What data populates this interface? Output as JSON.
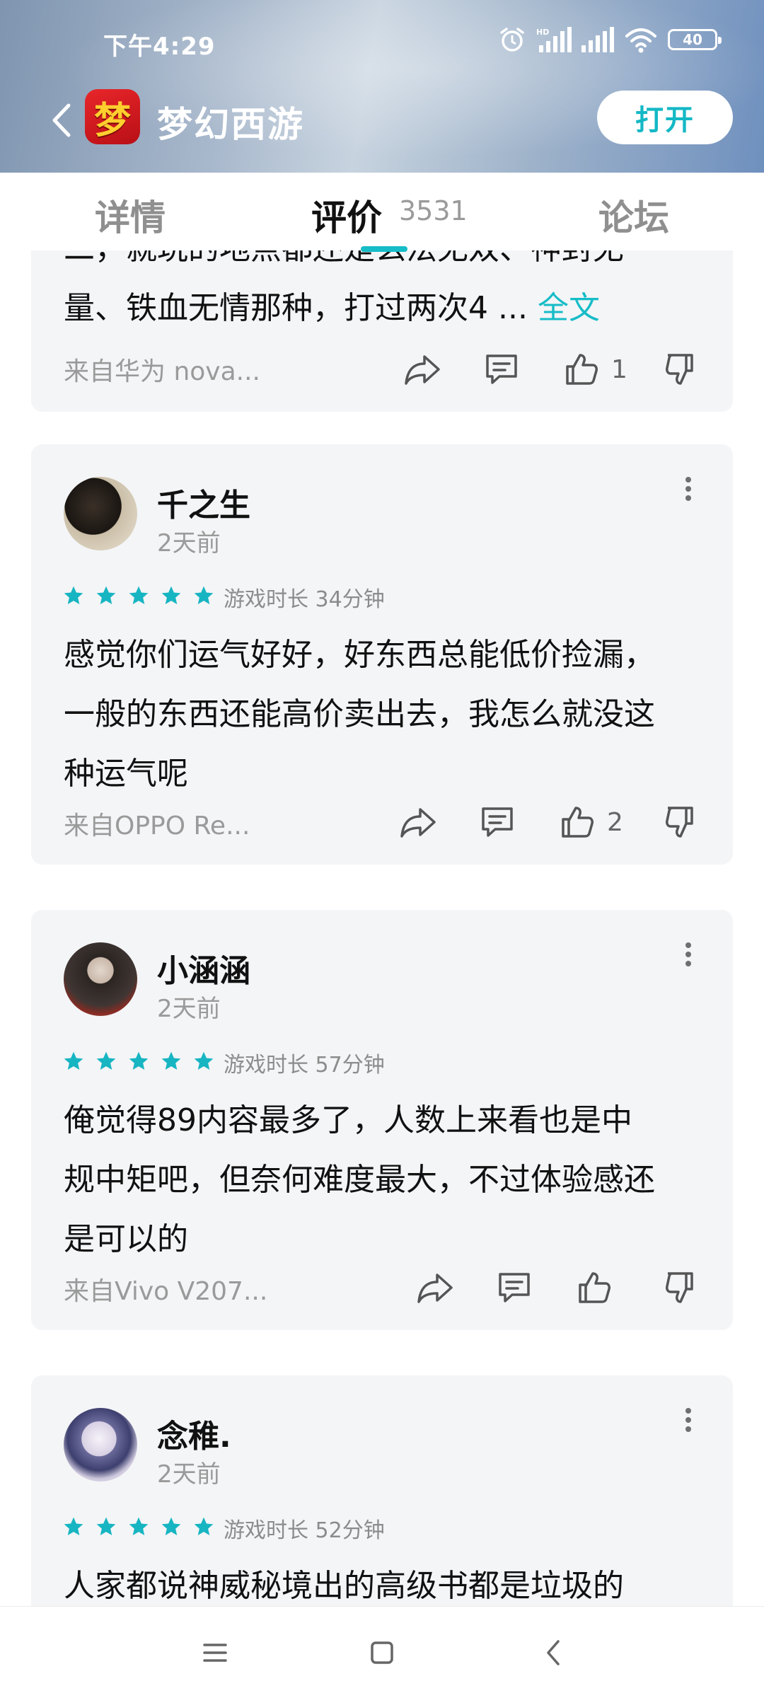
{
  "status_bar": {
    "time": "下午4:29",
    "battery": "40",
    "hd": "HD"
  },
  "app": {
    "title": "梦幻西游",
    "icon_glyph": "梦",
    "open_label": "打开"
  },
  "tabs": {
    "details": "详情",
    "reviews": "评价",
    "review_count": "3531",
    "forum": "论坛",
    "active": "reviews"
  },
  "partial_review": {
    "line1": "二，就玩的地点都还是玄法无双、神封无",
    "line2": "量、铁血无情那种，打过两次4 ...",
    "more_label": "全文",
    "source": "来自华为 nova...",
    "likes": "1"
  },
  "reviews": [
    {
      "username": "千之生",
      "time": "2天前",
      "stars": 5,
      "playtime": "游戏时长 34分钟",
      "lines": [
        "感觉你们运气好好，好东西总能低价捡漏，",
        "一般的东西还能高价卖出去，我怎么就没这",
        "种运气呢"
      ],
      "source": "来自OPPO Re...",
      "likes": "2"
    },
    {
      "username": "小涵涵",
      "time": "2天前",
      "stars": 5,
      "playtime": "游戏时长 57分钟",
      "lines": [
        "俺觉得89内容最多了，人数上来看也是中",
        "规中矩吧，但奈何难度最大，不过体验感还",
        "是可以的"
      ],
      "source": "来自Vivo V207...",
      "likes": ""
    },
    {
      "username": "念稚.",
      "time": "2天前",
      "stars": 5,
      "playtime": "游戏时长 52分钟",
      "lines": [
        "人家都说神威秘境出的高级书都是垃圾的"
      ],
      "source": "",
      "likes": ""
    }
  ],
  "colors": {
    "accent": "#16bcc7",
    "card_bg": "#f4f5f7",
    "star": "#17b5c2"
  }
}
